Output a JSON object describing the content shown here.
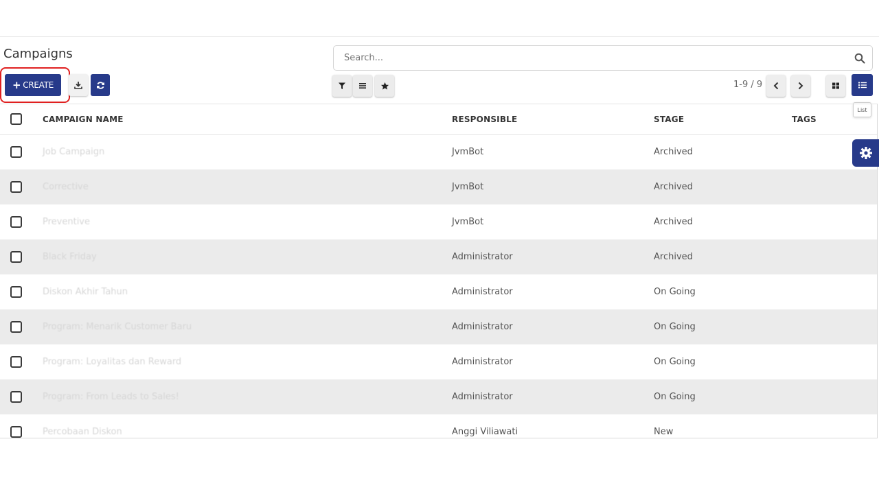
{
  "header": {
    "title": "Campaigns"
  },
  "search": {
    "placeholder": "Search..."
  },
  "toolbar": {
    "create_label": "CREATE",
    "pager": "1-9 / 9",
    "list_tooltip": "List"
  },
  "colors": {
    "primary": "#273a8a",
    "highlight": "#e02020",
    "row_alt": "#ebebeb"
  },
  "icons": {
    "create": "plus-icon",
    "download": "download-icon",
    "refresh": "refresh-icon",
    "filter": "filter-icon",
    "group": "group-by-icon",
    "favorite": "star-icon",
    "prev": "chevron-left-icon",
    "next": "chevron-right-icon",
    "kanban": "kanban-icon",
    "list": "list-icon",
    "settings": "gear-icon",
    "search": "search-icon"
  },
  "table": {
    "columns": [
      "CAMPAIGN NAME",
      "RESPONSIBLE",
      "STAGE",
      "TAGS"
    ],
    "rows": [
      {
        "name": "Job Campaign",
        "responsible": "JvmBot",
        "stage": "Archived"
      },
      {
        "name": "Corrective",
        "responsible": "JvmBot",
        "stage": "Archived"
      },
      {
        "name": "Preventive",
        "responsible": "JvmBot",
        "stage": "Archived"
      },
      {
        "name": "Black Friday",
        "responsible": "Administrator",
        "stage": "Archived"
      },
      {
        "name": "Diskon Akhir Tahun",
        "responsible": "Administrator",
        "stage": "On Going"
      },
      {
        "name": "Program: Menarik Customer Baru",
        "responsible": "Administrator",
        "stage": "On Going"
      },
      {
        "name": "Program: Loyalitas dan Reward",
        "responsible": "Administrator",
        "stage": "On Going"
      },
      {
        "name": "Program: From Leads to Sales!",
        "responsible": "Administrator",
        "stage": "On Going"
      },
      {
        "name": "Percobaan Diskon",
        "responsible": "Anggi Viliawati",
        "stage": "New"
      }
    ]
  }
}
